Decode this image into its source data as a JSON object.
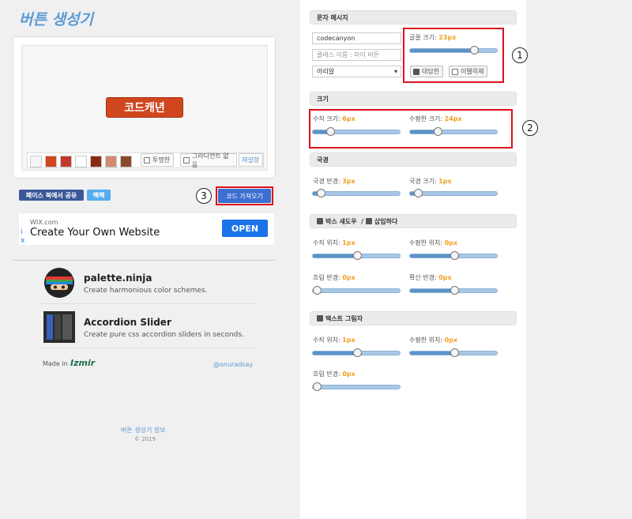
{
  "app_title": "버튼 생성기",
  "preview": {
    "button_text": "코드캐년",
    "swatch_colors": [
      "#f5f5f5",
      "#d0461e",
      "#c0392b",
      "#ffffff",
      "#8b2a12",
      "#d08a72",
      "#8a4a2a"
    ],
    "transparent_label": "투명한",
    "no_gradient_label": "그라디언트 없음",
    "reset_label": "재설정"
  },
  "share": {
    "facebook": "페이스 북에서 공유",
    "tweet": "짹짹",
    "get_code": "코드 가져오기"
  },
  "annotations": [
    "1",
    "2",
    "3"
  ],
  "ad": {
    "source": "WIX.com",
    "title": "Create Your Own Website",
    "cta": "OPEN",
    "info_icon": "i",
    "close_icon": "x"
  },
  "apps": [
    {
      "name": "palette.ninja",
      "desc": "Create harmonious color schemes.",
      "icon": "ninja-icon"
    },
    {
      "name": "Accordion Slider",
      "desc": "Create pure css accordion sliders in seconds.",
      "icon": "accordion-icon"
    }
  ],
  "footer": {
    "made_in": "Made in",
    "made_in_logo": "Izmir",
    "author": "@onuradsay",
    "about": "버튼 생성기 정보",
    "copyright": "© 2019"
  },
  "text_section": {
    "heading": "문자 메시지",
    "text_value": "codecanyon",
    "class_placeholder": "클래스 이름 : 마이 버튼",
    "font_select": "아리알",
    "font_size_label": "글꼴 크기:",
    "font_size_value": "23px",
    "font_size_fraction": 0.75,
    "bold_label": "대담한",
    "italic_label": "이탤릭체"
  },
  "size_section": {
    "heading": "크기",
    "vertical_label": "수직 크기:",
    "vertical_value": "6px",
    "vertical_fraction": 0.17,
    "horizontal_label": "수평한 크기:",
    "horizontal_value": "24px",
    "horizontal_fraction": 0.3
  },
  "border_section": {
    "heading": "국경",
    "radius_label": "국경 반경:",
    "radius_value": "3px",
    "radius_fraction": 0.05,
    "size_label": "국경 크기:",
    "size_value": "1px",
    "size_fraction": 0.05
  },
  "box_shadow_section": {
    "heading": "박스 섀도우",
    "separator": "/",
    "inset_label": "삽입하다",
    "vpos_label": "수직 위치:",
    "vpos_value": "1px",
    "vpos_fraction": 0.5,
    "hpos_label": "수평한 위치:",
    "hpos_value": "0px",
    "hpos_fraction": 0.5,
    "blur_label": "흐림 반경:",
    "blur_value": "0px",
    "blur_fraction": 0.0,
    "spread_label": "확산 반경:",
    "spread_value": "0px",
    "spread_fraction": 0.5
  },
  "text_shadow_section": {
    "heading": "텍스트 그림자",
    "vpos_label": "수직 위치:",
    "vpos_value": "1px",
    "vpos_fraction": 0.5,
    "hpos_label": "수평한 위치:",
    "hpos_value": "0px",
    "hpos_fraction": 0.5,
    "blur_label": "흐림 반경:",
    "blur_value": "0px",
    "blur_fraction": 0.0
  },
  "colors": {
    "accent": "#5b9bd5",
    "value": "#f0a020",
    "button": "#d0461e",
    "annotation": "#e0101a"
  }
}
